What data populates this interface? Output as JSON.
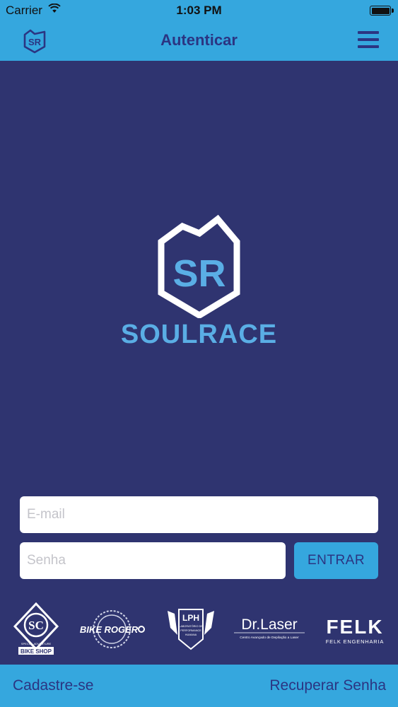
{
  "status_bar": {
    "carrier": "Carrier",
    "time": "1:03 PM"
  },
  "nav": {
    "title": "Autenticar",
    "logo_text": "SR"
  },
  "brand": {
    "logo_text": "SR",
    "name": "SOULRACE"
  },
  "form": {
    "email_placeholder": "E-mail",
    "password_placeholder": "Senha",
    "enter_label": "ENTRAR"
  },
  "sponsors": {
    "bike_shop": {
      "logo_text": "SC",
      "tagline": "SPECIAL  ADVENTURE",
      "label": "BIKE SHOP"
    },
    "bike_roger": {
      "label": "BIKE ROGER"
    },
    "lph": {
      "label": "LPH",
      "line1": "LABORATÓRIO DE",
      "line2": "PERFORMANCE",
      "line3": "HUMANA"
    },
    "dr_laser": {
      "label": "Dr.Laser",
      "subtitle": "Centro Avançado de Depilação a Laser"
    },
    "felk": {
      "label": "FELK",
      "subtitle": "FELK ENGENHARIA"
    }
  },
  "footer": {
    "signup_label": "Cadastre-se",
    "recover_label": "Recuperar Senha"
  },
  "colors": {
    "background": "#2f3470",
    "accent": "#35a7de",
    "nav_text": "#2b3582",
    "brand_text": "#5aaee5"
  }
}
